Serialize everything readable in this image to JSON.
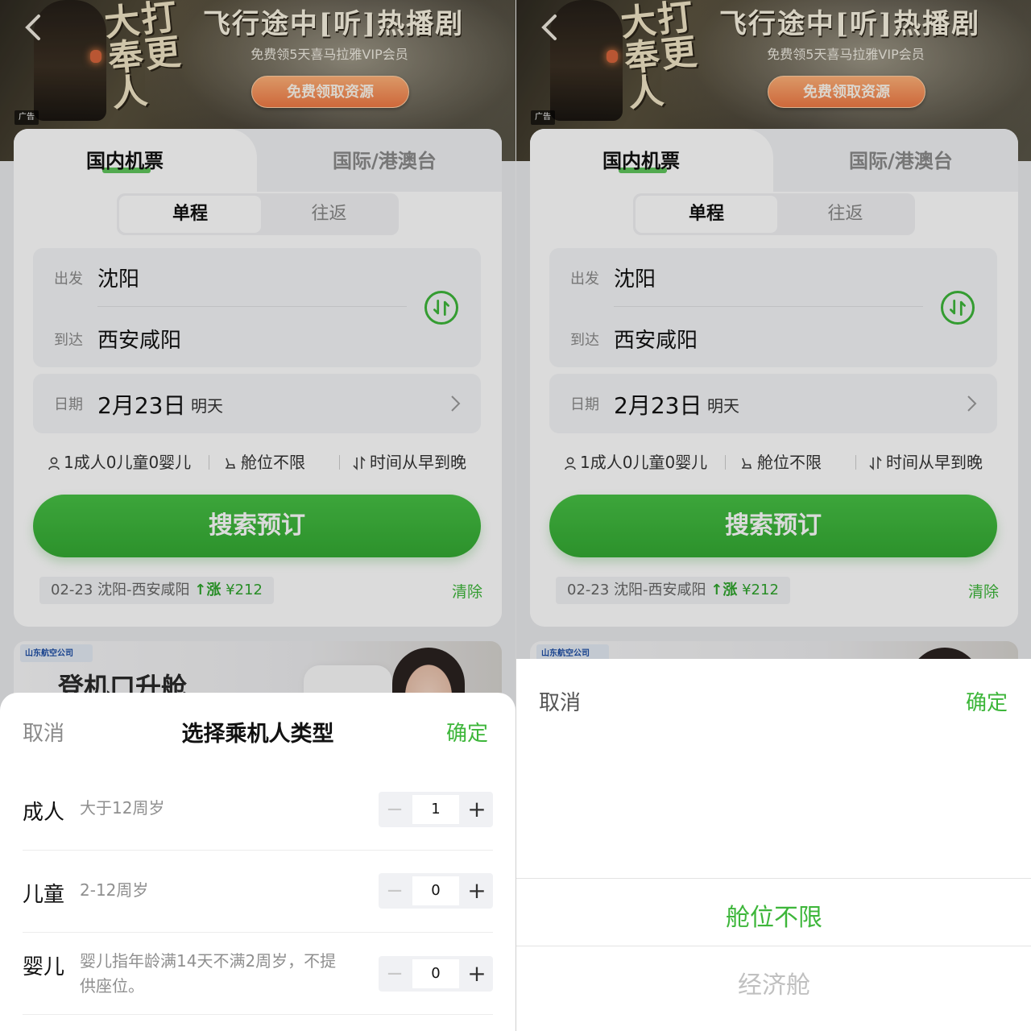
{
  "ad": {
    "title": "飞行途中[听]热播剧",
    "subtitle": "免费领5天喜马拉雅VIP会员",
    "button": "免费领取资源",
    "tag": "广告",
    "calligraphy": "大打奉更人"
  },
  "tabs": {
    "domestic": "国内机票",
    "international": "国际/港澳台"
  },
  "trip_type": {
    "oneway": "单程",
    "roundtrip": "往返"
  },
  "route": {
    "from_label": "出发",
    "from_city": "沈阳",
    "to_label": "到达",
    "to_city": "西安咸阳"
  },
  "date": {
    "label": "日期",
    "value": "2月23日",
    "day": "明天"
  },
  "options": {
    "passengers": "1成人0儿童0婴儿",
    "cabin": "舱位不限",
    "sort": "时间从早到晚"
  },
  "search_button": "搜索预订",
  "history": {
    "date": "02-23",
    "route": "沈阳-西安咸阳",
    "trend": "涨",
    "price": "¥212",
    "clear": "清除"
  },
  "ad2": {
    "headline": "登机口升舱",
    "airline": "山东航空公司"
  },
  "passenger_sheet": {
    "cancel": "取消",
    "title": "选择乘机人类型",
    "confirm": "确定",
    "rows": [
      {
        "name": "成人",
        "desc": "大于12周岁",
        "count": "1"
      },
      {
        "name": "儿童",
        "desc": "2-12周岁",
        "count": "0"
      },
      {
        "name": "婴儿",
        "desc": "婴儿指年龄满14天不满2周岁，不提供座位。",
        "count": "0"
      }
    ],
    "minus": "−",
    "plus": "+"
  },
  "cabin_sheet": {
    "cancel": "取消",
    "confirm": "确定",
    "options": [
      "舱位不限",
      "经济舱"
    ],
    "selected": "舱位不限"
  },
  "colors": {
    "accent": "#3db63a",
    "button": "#3dad3a"
  }
}
